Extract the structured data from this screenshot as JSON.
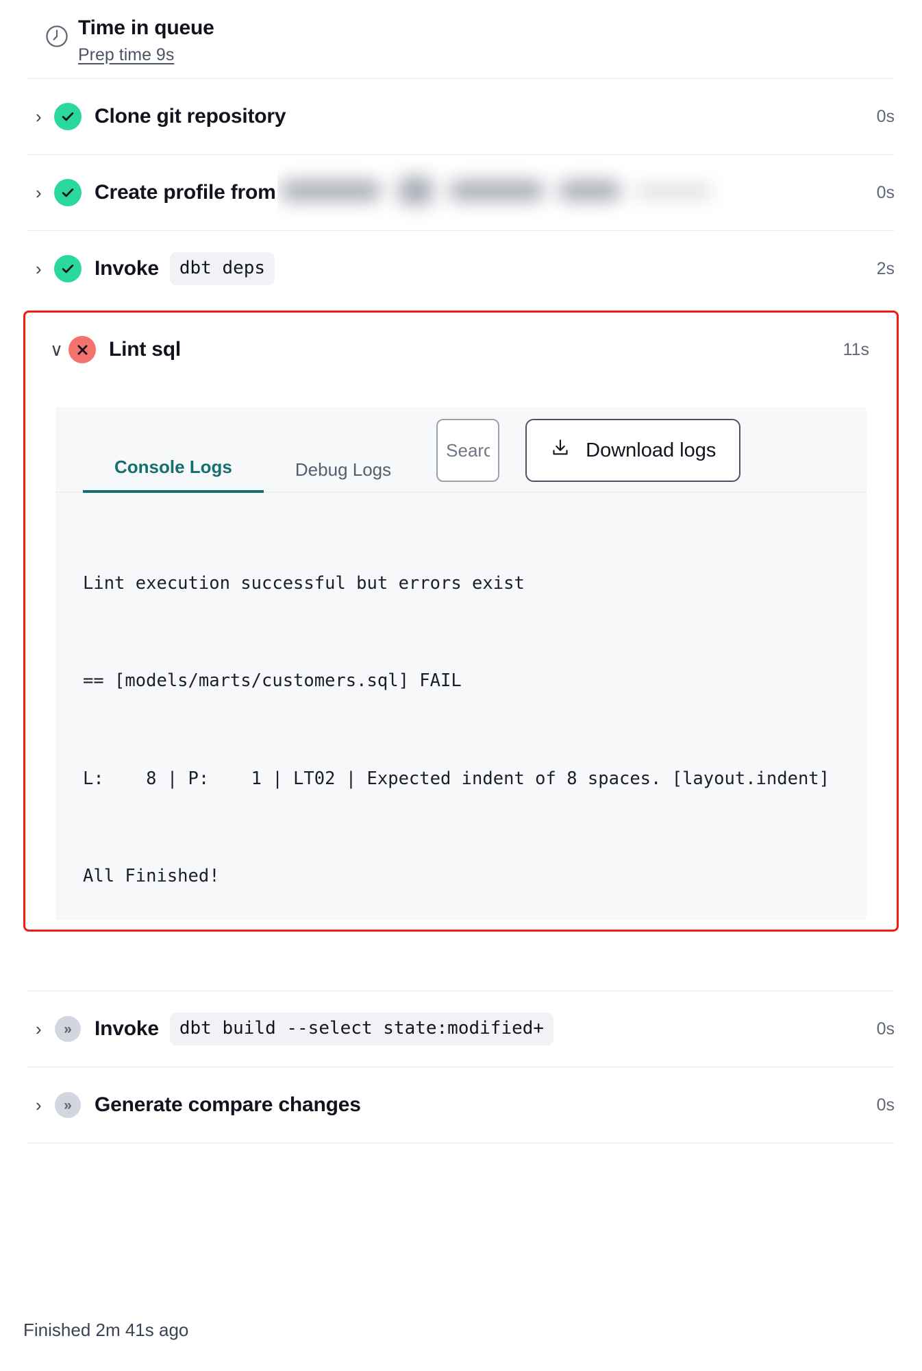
{
  "queue": {
    "icon": "clock-icon",
    "title": "Time in queue",
    "prep_time_label": "Prep time 9s"
  },
  "steps": [
    {
      "id": "clone-git-repository",
      "chevron": "›",
      "status": "success",
      "title": "Clone git repository",
      "command": null,
      "redacted": false,
      "duration": "0s"
    },
    {
      "id": "create-profile-from",
      "chevron": "›",
      "status": "success",
      "title": "Create profile from",
      "command": null,
      "redacted": true,
      "duration": "0s"
    },
    {
      "id": "invoke-dbt-deps",
      "chevron": "›",
      "status": "success",
      "title": "Invoke",
      "command": "dbt deps",
      "redacted": false,
      "duration": "2s"
    }
  ],
  "failed_step": {
    "id": "lint-sql",
    "chevron": "∨",
    "status": "error",
    "title": "Lint sql",
    "duration": "11s",
    "highlighted": true,
    "highlight_color": "#f61b11",
    "logs": {
      "tabs": [
        {
          "label": "Console Logs",
          "active": true
        },
        {
          "label": "Debug Logs",
          "active": false
        }
      ],
      "search_placeholder": "Search",
      "search_value": "",
      "download_label": "Download logs",
      "download_icon": "download-icon",
      "lines": [
        "Lint execution successful but errors exist",
        "== [models/marts/customers.sql] FAIL",
        "L:    8 | P:    1 | LT02 | Expected indent of 8 spaces. [layout.indent]",
        "All Finished!"
      ]
    }
  },
  "steps_after": [
    {
      "id": "invoke-dbt-build",
      "chevron": "›",
      "status": "skipped",
      "title": "Invoke",
      "command": "dbt build --select state:modified+",
      "redacted": false,
      "duration": "0s"
    },
    {
      "id": "generate-compare-changes",
      "chevron": "›",
      "status": "skipped",
      "title": "Generate compare changes",
      "command": null,
      "redacted": false,
      "duration": "0s"
    }
  ],
  "footer": {
    "finished_label": "Finished 2m 41s ago"
  },
  "colors": {
    "success": "#2bd89b",
    "error": "#f4726e",
    "skipped": "#d3d6de",
    "accent_tab": "#14706f",
    "highlight": "#f61b11",
    "log_bg": "#f7f8fa",
    "divider": "#e9eaee"
  }
}
